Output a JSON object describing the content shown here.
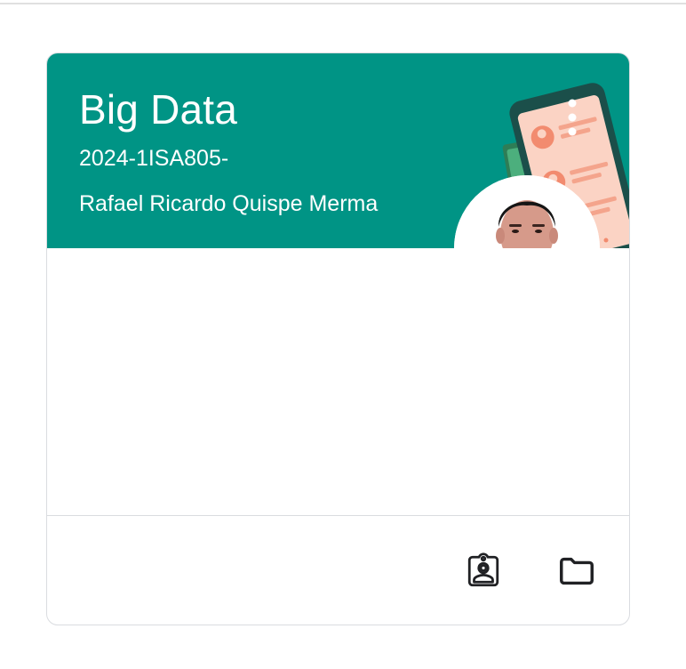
{
  "card": {
    "title": "Big Data",
    "section": "2024-1ISA805-",
    "teacher": "Rafael Ricardo Quispe Merma"
  },
  "icons": {
    "work": "assignment-ind-icon",
    "folder": "folder-icon"
  },
  "colors": {
    "header": "#009485",
    "border": "#dadce0",
    "text_on_header": "#ffffff",
    "icon": "#202124"
  }
}
